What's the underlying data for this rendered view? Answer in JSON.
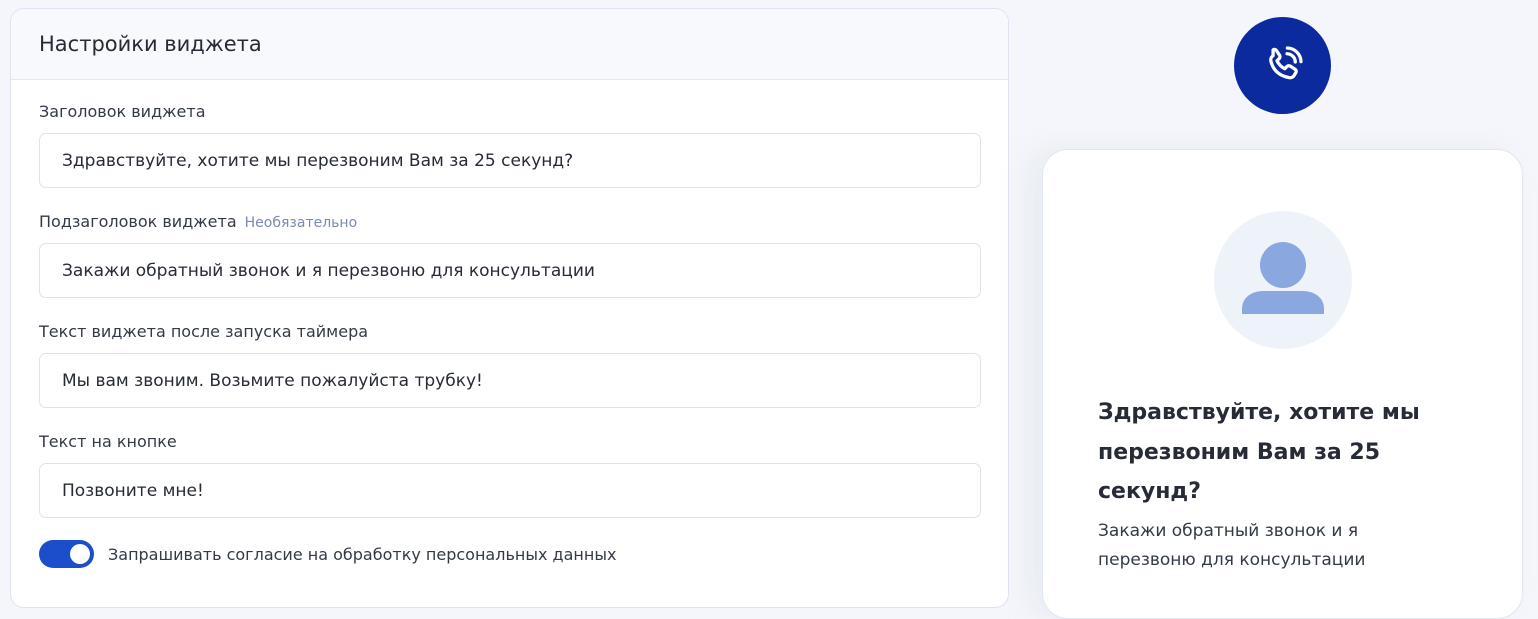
{
  "settings": {
    "title": "Настройки виджета",
    "fields": [
      {
        "label": "Заголовок виджета",
        "optional": "",
        "value": "Здравствуйте, хотите мы перезвоним Вам за 25 секунд?"
      },
      {
        "label": "Подзаголовок виджета",
        "optional": "Необязательно",
        "value": "Закажи обратный звонок и я перезвоню для консультации"
      },
      {
        "label": "Текст виджета после запуска таймера",
        "optional": "",
        "value": "Мы вам звоним. Возьмите пожалуйста трубку!"
      },
      {
        "label": "Текст на кнопке",
        "optional": "",
        "value": "Позвоните мне!"
      }
    ],
    "consent": {
      "label": "Запрашивать согласие на обработку персональных данных",
      "enabled": true
    }
  },
  "preview": {
    "call_button_icon": "phone-ringing-icon",
    "avatar_icon": "user-avatar-icon",
    "title": "Здравствуйте, хотите мы перезвоним Вам за 25 секунд?",
    "subtitle": "Закажи обратный звонок и я перезвоню для консультации"
  },
  "colors": {
    "accent": "#1c4ecb",
    "call_button": "#0b2a9e",
    "avatar_fill": "#8aa7df",
    "muted_text": "#7b89b3"
  }
}
